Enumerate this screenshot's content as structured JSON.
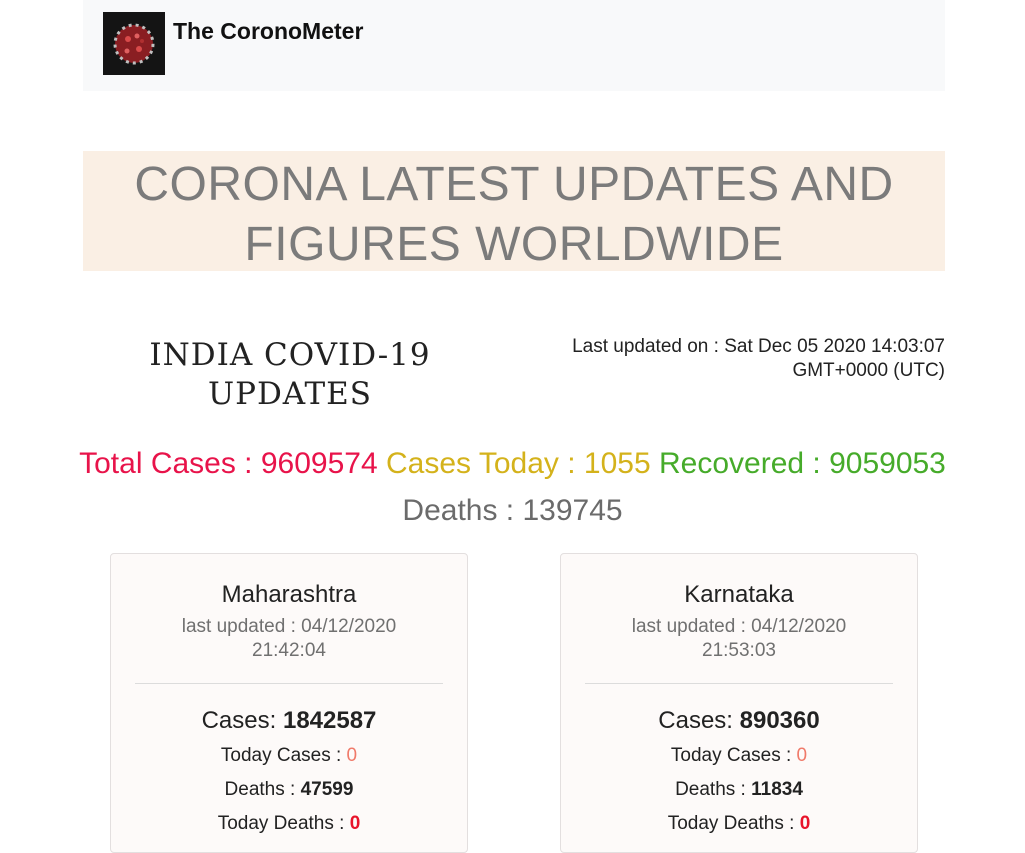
{
  "navbar": {
    "brand": "The CoronoMeter",
    "logo_icon": "coronavirus-icon"
  },
  "hero": {
    "title_line1": "CORONA LATEST UPDATES AND",
    "title_line2": "FIGURES WORLDWIDE"
  },
  "india": {
    "title_line1": "INDIA COVID-19",
    "title_line2": "UPDATES",
    "last_updated_line1": "Last updated on : Sat Dec 05 2020 14:03:07",
    "last_updated_line2": "GMT+0000 (UTC)"
  },
  "stats": {
    "total_label": "Total Cases : ",
    "total_value": "9609574",
    "today_label": "Cases Today : ",
    "today_value": "1055",
    "recovered_label": "Recovered : ",
    "recovered_value": "9059053",
    "deaths_label": "Deaths : ",
    "deaths_value": "139745",
    "colors": {
      "total": "#e8134a",
      "today": "#d4b21b",
      "recovered": "#46ab2a",
      "deaths": "#6b6b6b"
    }
  },
  "states": [
    {
      "name": "Maharashtra",
      "updated_line1": "last updated : 04/12/2020",
      "updated_line2": "21:42:04",
      "cases_label": "Cases: ",
      "cases": "1842587",
      "today_label": "Today Cases : ",
      "today": "0",
      "deaths_label": "Deaths : ",
      "deaths": "47599",
      "today_deaths_label": "Today Deaths : ",
      "today_deaths": "0"
    },
    {
      "name": "Karnataka",
      "updated_line1": "last updated : 04/12/2020",
      "updated_line2": "21:53:03",
      "cases_label": "Cases: ",
      "cases": "890360",
      "today_label": "Today Cases : ",
      "today": "0",
      "deaths_label": "Deaths : ",
      "deaths": "11834",
      "today_deaths_label": "Today Deaths : ",
      "today_deaths": "0"
    }
  ]
}
